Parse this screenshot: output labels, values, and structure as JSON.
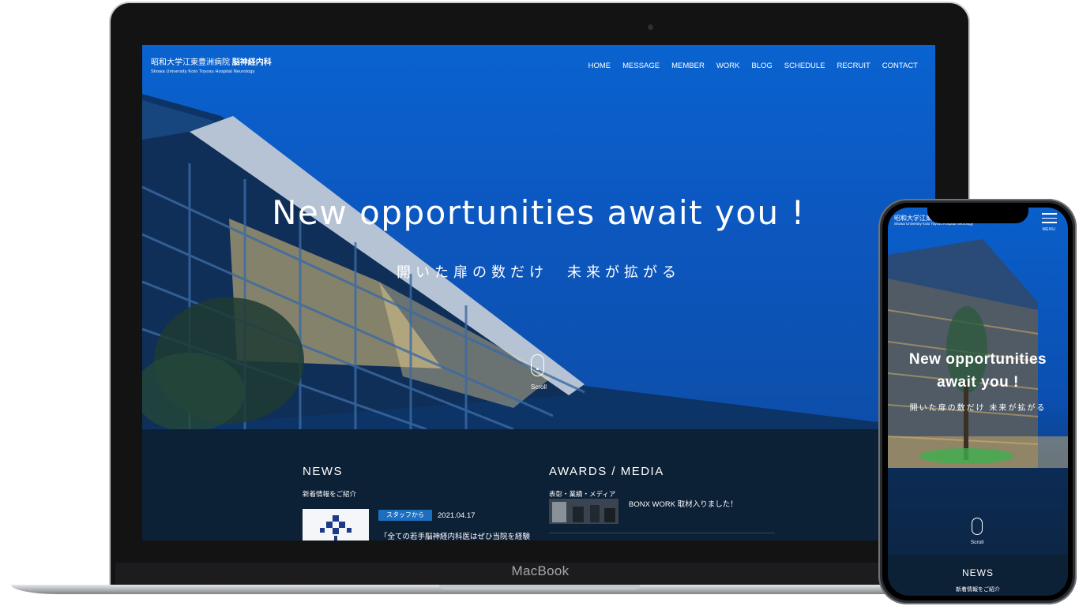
{
  "laptop": {
    "brand": "MacBook",
    "site": {
      "logo_main": "昭和大学江東豊洲病院",
      "logo_dept": "脳神経内科",
      "logo_sub": "Showa University Koto Toyosu Hospital  Neurology",
      "nav": [
        "HOME",
        "MESSAGE",
        "MEMBER",
        "WORK",
        "BLOG",
        "SCHEDULE",
        "RECRUIT",
        "CONTACT"
      ],
      "hero_title": "New opportunities await you !",
      "hero_subtitle": "開いた扉の数だけ　未来が拡がる",
      "scroll_label": "Scroll",
      "news": {
        "title": "NEWS",
        "subtitle": "新着情報をご紹介",
        "item": {
          "badge": "スタッフから",
          "date": "2021.04.17",
          "title": "「全ての若手脳神経内科医はぜひ当院を経験"
        }
      },
      "awards": {
        "title": "AWARDS / MEDIA",
        "subtitle": "表彰・業績・メディア",
        "item_title": "BONX WORK 取材入りました！"
      }
    }
  },
  "phone": {
    "logo_main": "昭和大学江東",
    "logo_sub": "Showa University Koto Toyosu Hospital  Neurology",
    "menu_label": "MENU",
    "hero_title_line1": "New opportunities",
    "hero_title_line2": "await you !",
    "hero_subtitle": "開いた扉の数だけ 未来が拡がる",
    "scroll_label": "Scroll",
    "news_title": "NEWS",
    "news_subtitle": "新着情報をご紹介"
  },
  "colors": {
    "hero_blue": "#0a63cf",
    "dark_navy": "#0c2036",
    "badge_blue": "#1c6fc0"
  }
}
